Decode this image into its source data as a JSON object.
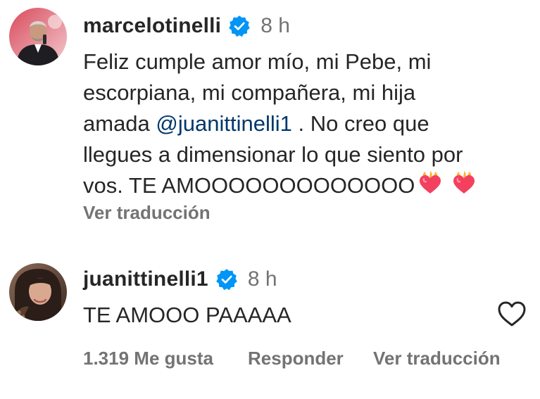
{
  "comments": [
    {
      "username": "marcelotinelli",
      "verified": true,
      "time": "8 h",
      "text_lines": [
        "Feliz cumple amor mío, mi Pebe, mi",
        "escorpiana, mi compañera, mi hija",
        "amada",
        "@juanittinelli1",
        ". No creo que",
        "llegues a dimensionar lo que siento por",
        "vos. TE AMOOOOOOOOOOOOO"
      ],
      "emojis": [
        "heart-on-fire-emoji",
        "heart-on-fire-emoji"
      ],
      "translate_label": "Ver traducción"
    },
    {
      "username": "juanittinelli1",
      "verified": true,
      "time": "8 h",
      "text": "TE AMOOO PAAAAA",
      "likes_label": "1.319 Me gusta",
      "reply_label": "Responder",
      "translate_label": "Ver traducción"
    }
  ],
  "colors": {
    "text": "#262626",
    "secondary": "#737373",
    "mention": "#00376b",
    "verified_badge": "#0095f6"
  },
  "icons": {
    "verified": "verified-badge-icon",
    "like": "heart-outline-icon"
  }
}
